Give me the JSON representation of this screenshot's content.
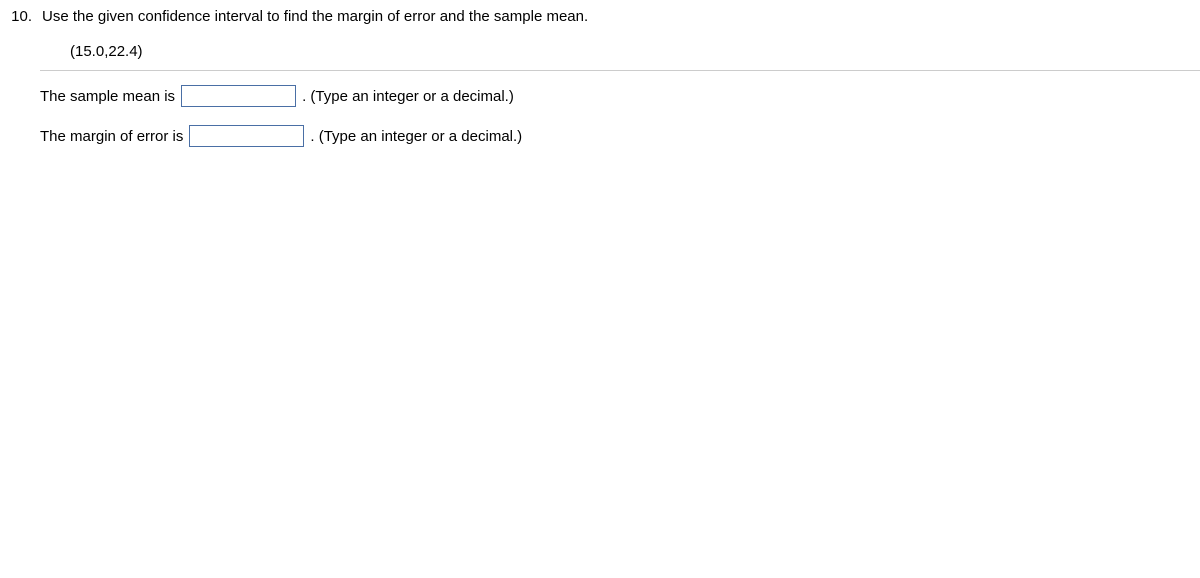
{
  "question": {
    "number": "10.",
    "prompt": "Use the given confidence interval to find the margin of error and the sample mean.",
    "interval": "(15.0,22.4)"
  },
  "answers": {
    "line1": {
      "label": "The sample mean is",
      "hint": ". (Type an integer or a decimal.)"
    },
    "line2": {
      "label": "The margin of error is",
      "hint": ". (Type an integer or a decimal.)"
    }
  }
}
